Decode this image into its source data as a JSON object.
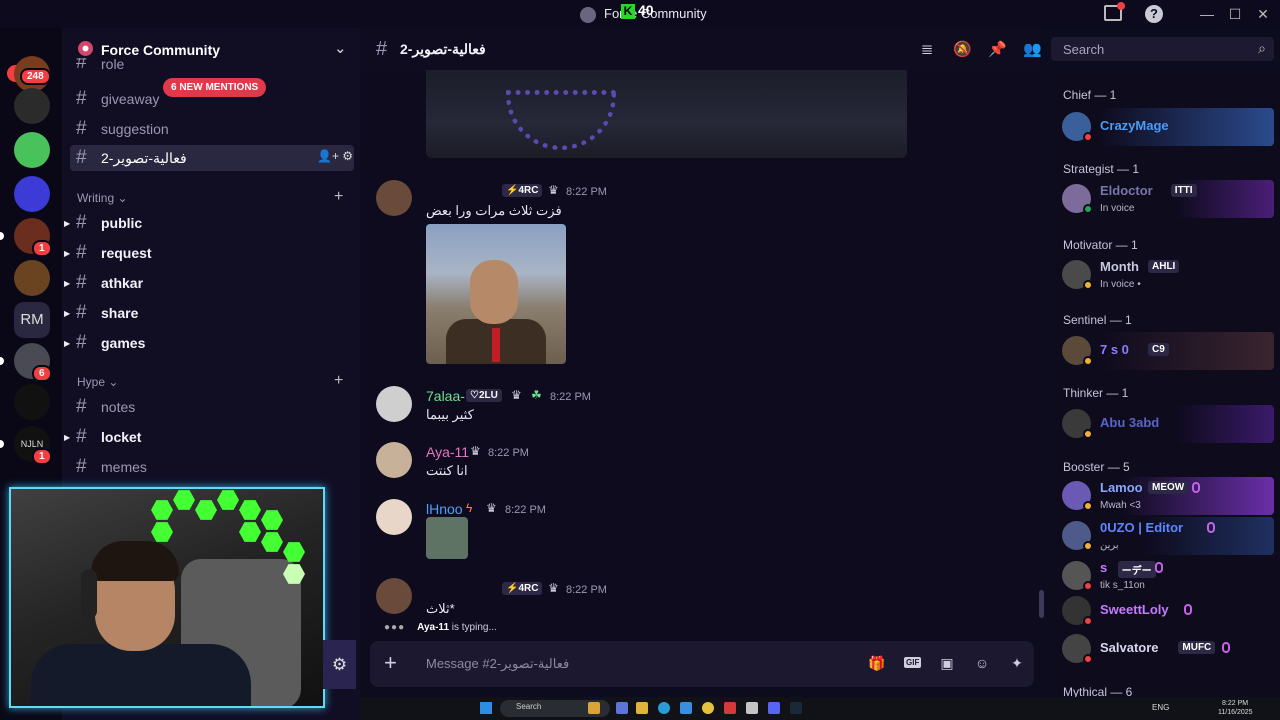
{
  "window": {
    "title": "Force Community",
    "kick_count": "40",
    "kick_letter": "K",
    "help_label": "?",
    "minimize": "—",
    "maximize": "☐",
    "close": "✕"
  },
  "rail": {
    "new_label": "NEW",
    "servers": [
      {
        "badge": "248",
        "color": "#7a3b1e"
      },
      {
        "badge": "",
        "color": "#2b2b2b"
      },
      {
        "badge": "",
        "color": "#49c25c"
      },
      {
        "badge": "",
        "color": "#3c3bd8"
      },
      {
        "badge": "1",
        "color": "#6a2d1e"
      },
      {
        "badge": "",
        "color": "#6a4421"
      },
      {
        "badge": "",
        "color": "#2a2840",
        "text": "RM"
      },
      {
        "badge": "6",
        "color": "#4a4a55"
      },
      {
        "badge": "",
        "color": "#111111"
      },
      {
        "badge": "1",
        "color": "#111111",
        "text": "NJLN"
      }
    ]
  },
  "sidebar": {
    "server_name": "Force Community",
    "mentions_label": "6 NEW MENTIONS",
    "channels_top": [
      {
        "name": "role"
      },
      {
        "name": "giveaway"
      },
      {
        "name": "suggestion"
      },
      {
        "name": "فعالية-تصوير-2",
        "active": true
      }
    ],
    "writing": {
      "label": "Writing",
      "channels": [
        "public",
        "request",
        "athkar",
        "share",
        "games"
      ]
    },
    "hype": {
      "label": "Hype",
      "channels": [
        {
          "name": "notes",
          "unread": false
        },
        {
          "name": "locket",
          "unread": true
        },
        {
          "name": "memes",
          "unread": false
        }
      ]
    },
    "chevron": "⌄",
    "add": "+"
  },
  "chat_header": {
    "hash": "#",
    "channel": "فعالية-تصوير-2",
    "search_placeholder": "Search"
  },
  "messages": [
    {
      "user": "",
      "tag": "4RC",
      "time": "8:22 PM",
      "text": "فزت ثلاث مرات ورا بعض",
      "color": "#e8e8f4",
      "has_image": true
    },
    {
      "user": "7alaa-",
      "tag": "2LU",
      "time": "8:22 PM",
      "text": "كثير بيبما",
      "color": "#6ee08f"
    },
    {
      "user": "Aya-11",
      "tag": "",
      "time": "8:22 PM",
      "text": "انا كنتت",
      "color": "#e477c2"
    },
    {
      "user": "lHnoo",
      "tag": "",
      "time": "8:22 PM",
      "text": "",
      "color": "#4fa1ff",
      "has_image": true
    },
    {
      "user": "",
      "tag": "4RC",
      "time": "8:22 PM",
      "text": "*ثلاث",
      "color": "#e8e8f4"
    }
  ],
  "typing": {
    "user": "Aya-11",
    "suffix": " is typing..."
  },
  "composer": {
    "placeholder": "Message #فعالية-تصوير-2",
    "plus": "+",
    "gif": "GIF"
  },
  "members": {
    "groups": [
      {
        "role": "Chief — 1",
        "members": [
          {
            "name": "CrazyMage",
            "color": "#4a9cf5",
            "sub": "",
            "tag": ""
          }
        ]
      },
      {
        "role": "Strategist — 1",
        "members": [
          {
            "name": "Eldoctor",
            "color": "#7875a8",
            "sub": "In voice",
            "tag": "ITTI"
          }
        ]
      },
      {
        "role": "Motivator — 1",
        "members": [
          {
            "name": "Month",
            "color": "#c9c7de",
            "sub": "In voice •",
            "tag": "AHLI"
          }
        ]
      },
      {
        "role": "Sentinel — 1",
        "members": [
          {
            "name": "7 s 0",
            "color": "#8a7fff",
            "sub": "",
            "tag": "C9"
          }
        ]
      },
      {
        "role": "Thinker — 1",
        "members": [
          {
            "name": "Abu 3abd",
            "color": "#5a64c8",
            "sub": "",
            "tag": ""
          }
        ]
      },
      {
        "role": "Booster — 5",
        "members": [
          {
            "name": "Lamoo",
            "color": "#86a8ff",
            "sub": "Mwah <3",
            "tag": "MEOW"
          },
          {
            "name": "0UZO | Editor",
            "color": "#5a87ff",
            "sub": "برين",
            "tag": ""
          },
          {
            "name": "s",
            "color": "#c47cff",
            "sub": "tik s_11on",
            "tag": "ーデー"
          },
          {
            "name": "SweettLoly",
            "color": "#c47cff",
            "sub": "",
            "tag": ""
          },
          {
            "name": "Salvatore",
            "color": "#d7d7ee",
            "sub": "",
            "tag": "MUFC"
          }
        ]
      },
      {
        "role": "Mythical — 6",
        "members": []
      }
    ]
  },
  "taskbar": {
    "search": "Search",
    "lang": "ENG",
    "time": "8:22 PM",
    "date": "11/16/2025"
  }
}
